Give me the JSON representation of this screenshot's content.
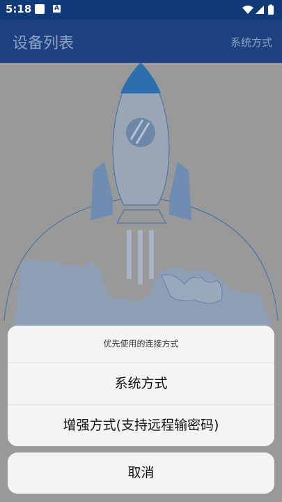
{
  "status": {
    "time": "5:18",
    "notification_badge": "A"
  },
  "app_bar": {
    "title": "设备列表",
    "action_label": "系统方式"
  },
  "action_sheet": {
    "title": "优先使用的连接方式",
    "options": [
      {
        "label": "系统方式"
      },
      {
        "label": "增强方式(支持远程输密码)"
      }
    ],
    "cancel_label": "取消"
  },
  "colors": {
    "status_bar": "#123a78",
    "app_bar": "#1e4280",
    "title_text": "#8ea1c3",
    "scrim_background": "#999999",
    "sheet_background": "#f4f4f4",
    "rocket_accent": "#2d6fad"
  },
  "icons": {
    "status_left": [
      "square-notification-icon",
      "a-notification-icon"
    ],
    "status_right": [
      "wifi-icon",
      "signal-icon",
      "battery-icon"
    ],
    "illustration": "rocket-over-planet-illustration"
  }
}
